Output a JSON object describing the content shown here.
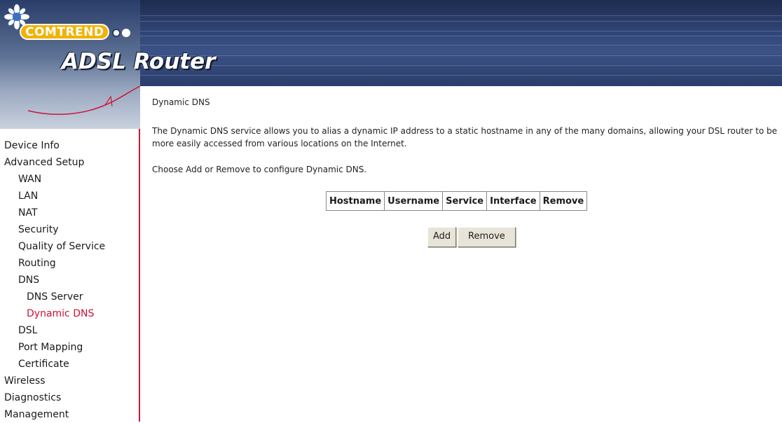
{
  "header": {
    "brand": "COMTREND",
    "product_title": "ADSL Router"
  },
  "sidebar": {
    "items": [
      {
        "label": "Device Info",
        "level": 0,
        "active": false
      },
      {
        "label": "Advanced Setup",
        "level": 0,
        "active": false
      },
      {
        "label": "WAN",
        "level": 1,
        "active": false
      },
      {
        "label": "LAN",
        "level": 1,
        "active": false
      },
      {
        "label": "NAT",
        "level": 1,
        "active": false
      },
      {
        "label": "Security",
        "level": 1,
        "active": false
      },
      {
        "label": "Quality of Service",
        "level": 1,
        "active": false
      },
      {
        "label": "Routing",
        "level": 1,
        "active": false
      },
      {
        "label": "DNS",
        "level": 1,
        "active": false
      },
      {
        "label": "DNS Server",
        "level": 2,
        "active": false
      },
      {
        "label": "Dynamic DNS",
        "level": 2,
        "active": true
      },
      {
        "label": "DSL",
        "level": 1,
        "active": false
      },
      {
        "label": "Port Mapping",
        "level": 1,
        "active": false
      },
      {
        "label": "Certificate",
        "level": 1,
        "active": false
      },
      {
        "label": "Wireless",
        "level": 0,
        "active": false
      },
      {
        "label": "Diagnostics",
        "level": 0,
        "active": false
      },
      {
        "label": "Management",
        "level": 0,
        "active": false
      }
    ]
  },
  "main": {
    "title": "Dynamic DNS",
    "description": "The Dynamic DNS service allows you to alias a dynamic IP address to a static hostname in any of the many domains, allowing your DSL router to be more easily accessed from various locations on the Internet.",
    "instructions": "Choose Add or Remove to configure Dynamic DNS.",
    "table": {
      "columns": [
        "Hostname",
        "Username",
        "Service",
        "Interface",
        "Remove"
      ]
    },
    "add_label": "Add",
    "remove_label": "Remove"
  },
  "colors": {
    "active_link": "#cc1133",
    "sidebar_border": "#c9173b",
    "banner": "#2f4475",
    "button_face": "#e8e4d8"
  }
}
